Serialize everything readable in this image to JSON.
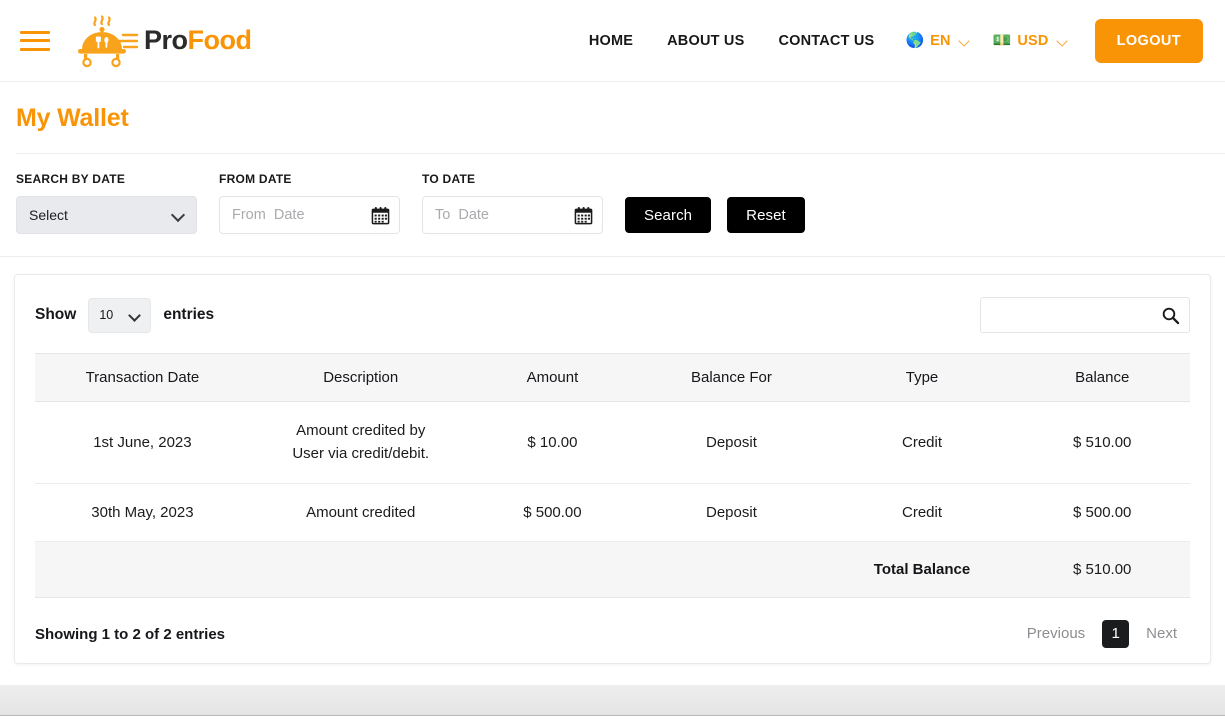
{
  "header": {
    "menu_icon": "hamburger-icon",
    "brand": {
      "part1": "Pro",
      "part2": "Food",
      "logo_icon": "food-cloche-logo"
    },
    "nav": [
      {
        "label": "HOME"
      },
      {
        "label": "ABOUT US"
      },
      {
        "label": "CONTACT US"
      }
    ],
    "language": {
      "icon": "globe-icon",
      "flag": "🌎",
      "label": "EN",
      "caret": "chevron-down-icon"
    },
    "currency": {
      "icon": "banknote-icon",
      "flag": "💵",
      "label": "USD",
      "caret": "chevron-down-icon"
    },
    "logout_label": "LOGOUT",
    "accent_color": "#f99406"
  },
  "page": {
    "title": "My Wallet"
  },
  "filters": {
    "search_by_date": {
      "label": "SEARCH BY DATE",
      "value": "Select"
    },
    "from_date": {
      "label": "FROM DATE",
      "value": "",
      "placeholder": "From  Date",
      "icon": "calendar-icon"
    },
    "to_date": {
      "label": "TO DATE",
      "value": "",
      "placeholder": "To  Date",
      "icon": "calendar-icon"
    },
    "search_button": "Search",
    "reset_button": "Reset"
  },
  "table_controls": {
    "show_label": "Show",
    "entries_label": "entries",
    "page_length": "10",
    "search_value": "",
    "search_placeholder": "",
    "search_icon": "search-icon"
  },
  "table": {
    "columns": [
      "Transaction Date",
      "Description",
      "Amount",
      "Balance For",
      "Type",
      "Balance"
    ],
    "rows": [
      {
        "date": "1st June, 2023",
        "description_line1": "Amount credited by",
        "description_line2": "User via credit/debit.",
        "amount": "$ 10.00",
        "balance_for": "Deposit",
        "type": "Credit",
        "balance": "$ 510.00"
      },
      {
        "date": "30th May, 2023",
        "description_line1": "Amount credited",
        "description_line2": "",
        "amount": "$ 500.00",
        "balance_for": "Deposit",
        "type": "Credit",
        "balance": "$ 500.00"
      }
    ],
    "total_label": "Total Balance",
    "total_value": "$ 510.00"
  },
  "footer": {
    "showing_text": "Showing 1 to 2 of 2 entries",
    "previous_label": "Previous",
    "current_page": "1",
    "next_label": "Next"
  }
}
